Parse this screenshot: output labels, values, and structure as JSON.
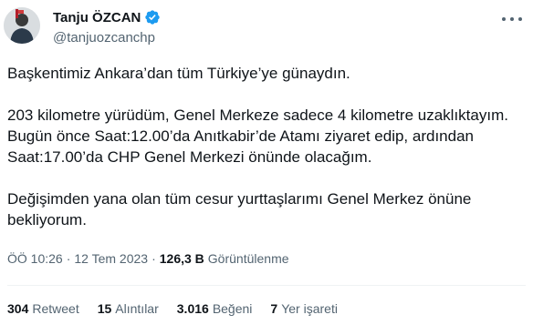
{
  "author": {
    "display_name": "Tanju ÖZCAN",
    "handle": "@tanjuozcanchp",
    "verified_icon": "verified-badge-icon",
    "avatar_icon": "profile-avatar"
  },
  "tweet": {
    "paragraphs": [
      "Başkentimiz Ankara’dan tüm Türkiye’ye günaydın.",
      "203 kilometre yürüdüm, Genel Merkeze sadece 4 kilometre uzaklıktayım. Bugün önce Saat:12.00’da Anıtkabir’de Atamı ziyaret edip, ardından Saat:17.00’da CHP Genel Merkezi önünde olacağım.",
      "Değişimden yana olan tüm cesur yurttaşlarımı Genel Merkez önüne bekliyorum."
    ]
  },
  "meta": {
    "time": "ÖÖ 10:26",
    "separator": "·",
    "date": "12 Tem 2023",
    "views_count": "126,3 B",
    "views_label": "Görüntülenme"
  },
  "stats": [
    {
      "count": "304",
      "label": "Retweet"
    },
    {
      "count": "15",
      "label": "Alıntılar"
    },
    {
      "count": "3.016",
      "label": "Beğeni"
    },
    {
      "count": "7",
      "label": "Yer işareti"
    }
  ],
  "colors": {
    "text_primary": "#0f1419",
    "text_secondary": "#536471",
    "verified_blue": "#1d9bf0",
    "divider": "#eff3f4"
  }
}
